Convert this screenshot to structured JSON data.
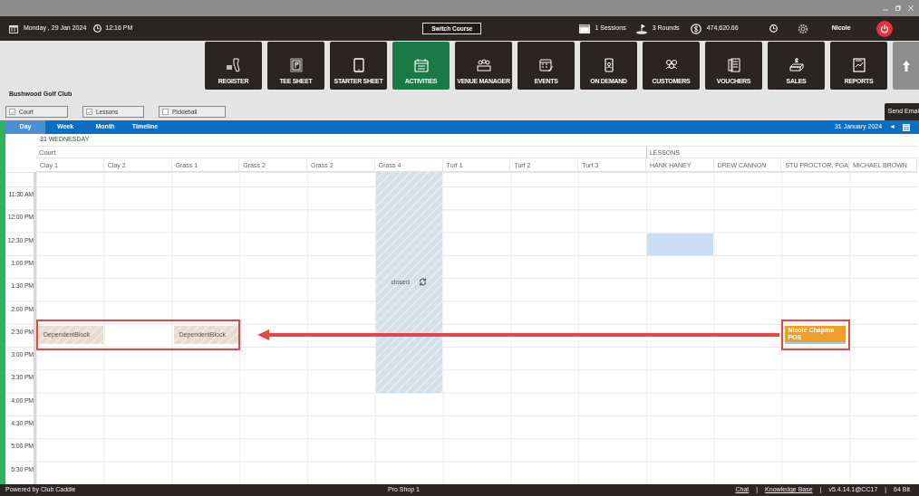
{
  "top_bar": {
    "date": "Monday , 29 Jan 2024",
    "time": "12:16 PM",
    "switch_button": "Switch Course",
    "sessions": "1 Sessions",
    "rounds": "3 Rounds",
    "balance": "474,620.66",
    "user": "Nicole"
  },
  "nav_tiles": [
    {
      "label": "REGISTER",
      "selected": false
    },
    {
      "label": "TEE SHEET",
      "selected": false
    },
    {
      "label": "STARTER SHEET",
      "selected": false
    },
    {
      "label": "ACTIVITIES",
      "selected": true
    },
    {
      "label": "VENUE MANAGER",
      "selected": false
    },
    {
      "label": "EVENTS",
      "selected": false
    },
    {
      "label": "ON DEMAND",
      "selected": false
    },
    {
      "label": "CUSTOMERS",
      "selected": false
    },
    {
      "label": "VOUCHERS",
      "selected": false
    },
    {
      "label": "SALES",
      "selected": false
    },
    {
      "label": "REPORTS",
      "selected": false
    }
  ],
  "club_name": "Bushwood Golf Club",
  "filters": [
    {
      "label": "Court",
      "checked": true
    },
    {
      "label": "Lessons",
      "checked": true
    },
    {
      "label": "Pickleball",
      "checked": false
    }
  ],
  "send_button": "Send Emai",
  "view_tabs": [
    {
      "label": "Day",
      "selected": true
    },
    {
      "label": "Week",
      "selected": false
    },
    {
      "label": "Month",
      "selected": false
    },
    {
      "label": "Timeline",
      "selected": false
    }
  ],
  "date_label": "31 January 2024",
  "prev_button": "◄",
  "schedule": {
    "day_heading": "31 WEDNESDAY",
    "groups": [
      {
        "label": "Court",
        "kind": "court",
        "columns": [
          "Clay 1",
          "Clay 2",
          "Grass 1",
          "Grass 2",
          "Grass 2",
          "Grass 4",
          "Turf 1",
          "Turf 2",
          "Turf 3"
        ]
      },
      {
        "label": "LESSONS",
        "kind": "lessons",
        "columns": [
          "HANK HANEY",
          "DREW CANNON",
          "STU PROCTOR, PGA",
          "MICHAEL BROWN"
        ]
      }
    ],
    "rows": [
      {
        "cells": [
          {
            "kind": "free"
          },
          {
            "kind": "free"
          },
          {
            "kind": "free"
          },
          {
            "kind": "free"
          },
          {
            "kind": "free"
          },
          {
            "kind": "closed"
          },
          {
            "kind": "free"
          },
          {
            "kind": "free"
          },
          {
            "kind": "free"
          },
          {
            "kind": "free"
          },
          {
            "kind": "free"
          },
          {
            "kind": "free"
          },
          {
            "kind": "free"
          }
        ]
      },
      {
        "time": "11:30 AM",
        "cells": [
          {
            "kind": "free"
          },
          {
            "kind": "free"
          },
          {
            "kind": "free"
          },
          {
            "kind": "free"
          },
          {
            "kind": "free"
          },
          {
            "kind": "closed"
          },
          {
            "kind": "free"
          },
          {
            "kind": "free"
          },
          {
            "kind": "free"
          },
          {
            "kind": "free"
          },
          {
            "kind": "free"
          },
          {
            "kind": "free"
          },
          {
            "kind": "free"
          }
        ]
      },
      {
        "time": "12:00 PM",
        "cells": [
          {
            "kind": "free"
          },
          {
            "kind": "free"
          },
          {
            "kind": "free"
          },
          {
            "kind": "free"
          },
          {
            "kind": "free"
          },
          {
            "kind": "closed"
          },
          {
            "kind": "free"
          },
          {
            "kind": "free"
          },
          {
            "kind": "free"
          },
          {
            "kind": "free"
          },
          {
            "kind": "free"
          },
          {
            "kind": "free"
          },
          {
            "kind": "free"
          }
        ]
      },
      {
        "time": "12:30 PM",
        "cells": [
          {
            "kind": "free"
          },
          {
            "kind": "free"
          },
          {
            "kind": "free"
          },
          {
            "kind": "free"
          },
          {
            "kind": "free"
          },
          {
            "kind": "closed"
          },
          {
            "kind": "free"
          },
          {
            "kind": "free"
          },
          {
            "kind": "free"
          },
          {
            "kind": "selected"
          },
          {
            "kind": "free"
          },
          {
            "kind": "free"
          },
          {
            "kind": "free"
          }
        ]
      },
      {
        "time": "1:00 PM",
        "cells": [
          {
            "kind": "free"
          },
          {
            "kind": "free"
          },
          {
            "kind": "free"
          },
          {
            "kind": "free"
          },
          {
            "kind": "free"
          },
          {
            "kind": "closed"
          },
          {
            "kind": "free"
          },
          {
            "kind": "free"
          },
          {
            "kind": "free"
          },
          {
            "kind": "free"
          },
          {
            "kind": "free"
          },
          {
            "kind": "free"
          },
          {
            "kind": "free"
          }
        ]
      },
      {
        "time": "1:30 PM",
        "cells": [
          {
            "kind": "free"
          },
          {
            "kind": "free"
          },
          {
            "kind": "free"
          },
          {
            "kind": "free"
          },
          {
            "kind": "free"
          },
          {
            "kind": "closed",
            "label": "closed"
          },
          {
            "kind": "free"
          },
          {
            "kind": "free"
          },
          {
            "kind": "free"
          },
          {
            "kind": "free"
          },
          {
            "kind": "free"
          },
          {
            "kind": "free"
          },
          {
            "kind": "free"
          }
        ]
      },
      {
        "time": "2:00 PM",
        "cells": [
          {
            "kind": "free"
          },
          {
            "kind": "free"
          },
          {
            "kind": "free"
          },
          {
            "kind": "free"
          },
          {
            "kind": "free"
          },
          {
            "kind": "closed"
          },
          {
            "kind": "free"
          },
          {
            "kind": "free"
          },
          {
            "kind": "free"
          },
          {
            "kind": "free"
          },
          {
            "kind": "free"
          },
          {
            "kind": "free"
          },
          {
            "kind": "free"
          }
        ]
      },
      {
        "time": "2:30 PM",
        "cells": [
          {
            "kind": "dependent-block",
            "title": "DependentBlock",
            "callout": true
          },
          {
            "kind": "free",
            "callout": true
          },
          {
            "kind": "dependent-block",
            "title": "DependentBlock",
            "callout": true
          },
          {
            "kind": "free"
          },
          {
            "kind": "free"
          },
          {
            "kind": "closed"
          },
          {
            "kind": "free"
          },
          {
            "kind": "free"
          },
          {
            "kind": "free"
          },
          {
            "kind": "free"
          },
          {
            "kind": "free"
          },
          {
            "kind": "booking",
            "title": "Nicole Chapma",
            "subtitle": "POS",
            "callout": true
          },
          {
            "kind": "free"
          }
        ]
      },
      {
        "time": "3:00 PM",
        "cells": [
          {
            "kind": "free"
          },
          {
            "kind": "free"
          },
          {
            "kind": "free"
          },
          {
            "kind": "free"
          },
          {
            "kind": "free"
          },
          {
            "kind": "closed"
          },
          {
            "kind": "free"
          },
          {
            "kind": "free"
          },
          {
            "kind": "free"
          },
          {
            "kind": "free"
          },
          {
            "kind": "free"
          },
          {
            "kind": "free"
          },
          {
            "kind": "free"
          }
        ]
      },
      {
        "time": "3:30 PM",
        "cells": [
          {
            "kind": "free"
          },
          {
            "kind": "free"
          },
          {
            "kind": "free"
          },
          {
            "kind": "free"
          },
          {
            "kind": "free"
          },
          {
            "kind": "closed"
          },
          {
            "kind": "free"
          },
          {
            "kind": "free"
          },
          {
            "kind": "free"
          },
          {
            "kind": "free"
          },
          {
            "kind": "free"
          },
          {
            "kind": "free"
          },
          {
            "kind": "free"
          }
        ]
      },
      {
        "time": "4:00 PM",
        "cells": [
          {
            "kind": "free"
          },
          {
            "kind": "free"
          },
          {
            "kind": "free"
          },
          {
            "kind": "free"
          },
          {
            "kind": "free"
          },
          {
            "kind": "free"
          },
          {
            "kind": "free"
          },
          {
            "kind": "free"
          },
          {
            "kind": "free"
          },
          {
            "kind": "free"
          },
          {
            "kind": "free"
          },
          {
            "kind": "free"
          },
          {
            "kind": "free"
          }
        ]
      },
      {
        "time": "4:30 PM",
        "cells": [
          {
            "kind": "free"
          },
          {
            "kind": "free"
          },
          {
            "kind": "free"
          },
          {
            "kind": "free"
          },
          {
            "kind": "free"
          },
          {
            "kind": "free"
          },
          {
            "kind": "free"
          },
          {
            "kind": "free"
          },
          {
            "kind": "free"
          },
          {
            "kind": "free"
          },
          {
            "kind": "free"
          },
          {
            "kind": "free"
          },
          {
            "kind": "free"
          }
        ]
      },
      {
        "time": "5:00 PM",
        "cells": [
          {
            "kind": "free"
          },
          {
            "kind": "free"
          },
          {
            "kind": "free"
          },
          {
            "kind": "free"
          },
          {
            "kind": "free"
          },
          {
            "kind": "free"
          },
          {
            "kind": "free"
          },
          {
            "kind": "free"
          },
          {
            "kind": "free"
          },
          {
            "kind": "free"
          },
          {
            "kind": "free"
          },
          {
            "kind": "free"
          },
          {
            "kind": "free"
          }
        ]
      },
      {
        "time": "5:30 PM",
        "cells": [
          {
            "kind": "free"
          },
          {
            "kind": "free"
          },
          {
            "kind": "free"
          },
          {
            "kind": "free"
          },
          {
            "kind": "free"
          },
          {
            "kind": "free"
          },
          {
            "kind": "free"
          },
          {
            "kind": "free"
          },
          {
            "kind": "free"
          },
          {
            "kind": "free"
          },
          {
            "kind": "free"
          },
          {
            "kind": "free"
          },
          {
            "kind": "free"
          }
        ]
      }
    ]
  },
  "footer": {
    "left": "Powered by Club Caddie",
    "center": "Pro Shop 1",
    "right": [
      {
        "kind": "link",
        "text": "Chat"
      },
      {
        "kind": "separator",
        "text": "|"
      },
      {
        "kind": "link",
        "text": "Knowledge Base"
      },
      {
        "kind": "separator",
        "text": "|"
      },
      {
        "kind": "text",
        "text": "v5.4.14.1@CC17"
      },
      {
        "kind": "separator",
        "text": "|"
      },
      {
        "kind": "text",
        "text": "64 Bit"
      }
    ]
  }
}
